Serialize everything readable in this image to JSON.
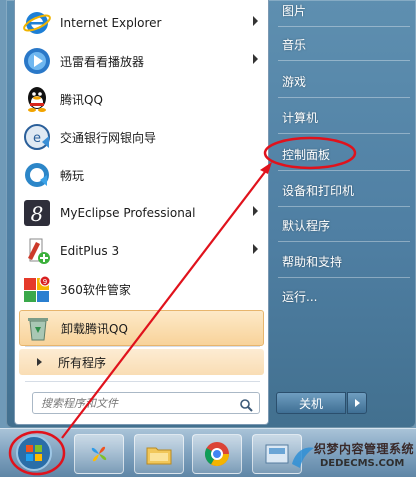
{
  "programs": [
    {
      "label": "Internet Explorer",
      "icon": "internet-explorer-icon",
      "has_submenu": true
    },
    {
      "label": "迅雷看看播放器",
      "icon": "xunlei-player-icon",
      "has_submenu": true
    },
    {
      "label": "腾讯QQ",
      "icon": "qq-penguin-icon",
      "has_submenu": false
    },
    {
      "label": "交通银行网银向导",
      "icon": "bank-guide-icon",
      "has_submenu": false
    },
    {
      "label": "畅玩",
      "icon": "changwan-icon",
      "has_submenu": false
    },
    {
      "label": "MyEclipse Professional",
      "icon": "myeclipse-icon",
      "has_submenu": true
    },
    {
      "label": "EditPlus 3",
      "icon": "editplus-icon",
      "has_submenu": true
    },
    {
      "label": "360软件管家",
      "icon": "360-software-manager-icon",
      "has_submenu": false
    },
    {
      "label": "卸载腾讯QQ",
      "icon": "recycle-bin-icon",
      "has_submenu": false
    }
  ],
  "all_programs": {
    "label": "所有程序"
  },
  "search": {
    "placeholder": "搜索程序和文件"
  },
  "right_links": [
    {
      "label": "图片"
    },
    {
      "label": "音乐"
    },
    {
      "label": "游戏"
    },
    {
      "label": "计算机"
    },
    {
      "label": "控制面板"
    },
    {
      "label": "设备和打印机"
    },
    {
      "label": "默认程序"
    },
    {
      "label": "帮助和支持"
    },
    {
      "label": "运行..."
    }
  ],
  "shutdown": {
    "label": "关机"
  },
  "taskbar": {
    "items": [
      "windows-start-orb-icon",
      "pinwheel-app-icon",
      "file-explorer-icon",
      "chrome-icon",
      "control-panel-icon"
    ]
  },
  "watermark": {
    "main": "织梦内容管理系统",
    "sub": "DEDECMS.COM"
  },
  "colors": {
    "highlight": "#f8d39a",
    "annotation": "#e0121c",
    "pane_blue": "#4f7fa3"
  }
}
